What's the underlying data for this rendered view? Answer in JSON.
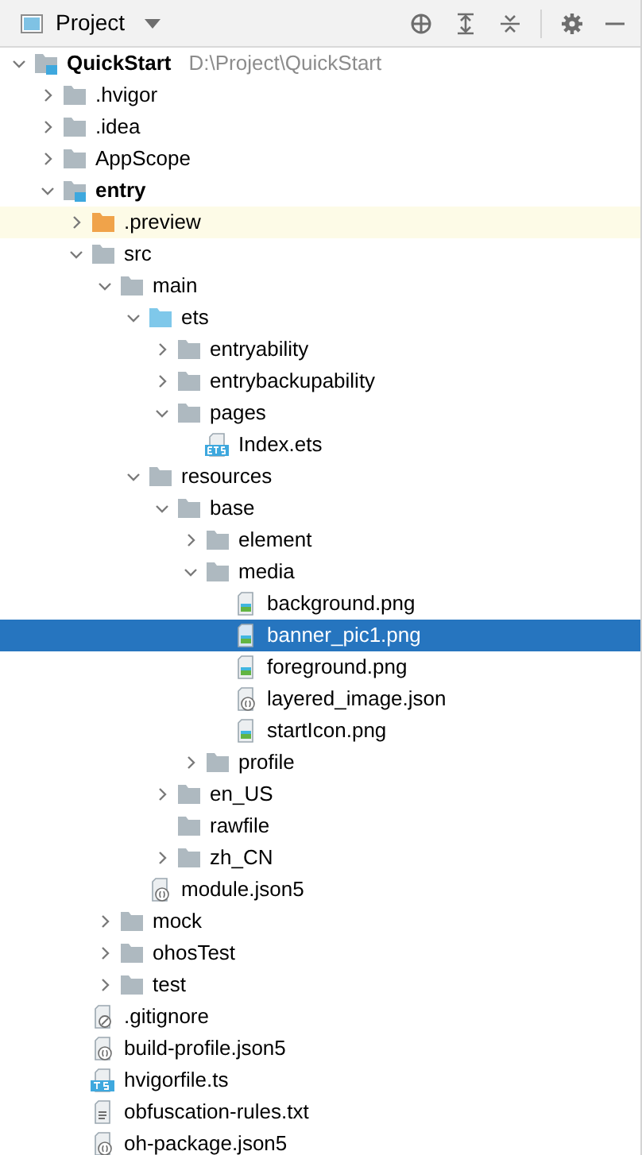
{
  "header": {
    "title": "Project"
  },
  "tree": [
    {
      "label": "QuickStart",
      "path": "D:\\Project\\QuickStart",
      "kind": "module",
      "expanded": true,
      "selected": false,
      "children": [
        {
          "label": ".hvigor",
          "kind": "folder",
          "expanded": false,
          "selected": false
        },
        {
          "label": ".idea",
          "kind": "folder",
          "expanded": false,
          "selected": false
        },
        {
          "label": "AppScope",
          "kind": "folder",
          "expanded": false,
          "selected": false
        },
        {
          "label": "entry",
          "kind": "module",
          "expanded": true,
          "selected": false,
          "children": [
            {
              "label": ".preview",
              "kind": "generated",
              "expanded": false,
              "selected": false
            },
            {
              "label": "src",
              "kind": "folder",
              "expanded": true,
              "selected": false,
              "children": [
                {
                  "label": "main",
                  "kind": "folder",
                  "expanded": true,
                  "selected": false,
                  "children": [
                    {
                      "label": "ets",
                      "kind": "source",
                      "expanded": true,
                      "selected": false,
                      "children": [
                        {
                          "label": "entryability",
                          "kind": "folder",
                          "expanded": false,
                          "selected": false
                        },
                        {
                          "label": "entrybackupability",
                          "kind": "folder",
                          "expanded": false,
                          "selected": false
                        },
                        {
                          "label": "pages",
                          "kind": "folder",
                          "expanded": true,
                          "selected": false,
                          "children": [
                            {
                              "label": "Index.ets",
                              "kind": "ets",
                              "selected": false
                            }
                          ]
                        }
                      ]
                    },
                    {
                      "label": "resources",
                      "kind": "folder",
                      "expanded": true,
                      "selected": false,
                      "children": [
                        {
                          "label": "base",
                          "kind": "folder",
                          "expanded": true,
                          "selected": false,
                          "children": [
                            {
                              "label": "element",
                              "kind": "folder",
                              "expanded": false,
                              "selected": false
                            },
                            {
                              "label": "media",
                              "kind": "folder",
                              "expanded": true,
                              "selected": false,
                              "children": [
                                {
                                  "label": "background.png",
                                  "kind": "image",
                                  "selected": false
                                },
                                {
                                  "label": "banner_pic1.png",
                                  "kind": "image",
                                  "selected": true
                                },
                                {
                                  "label": "foreground.png",
                                  "kind": "image",
                                  "selected": false
                                },
                                {
                                  "label": "layered_image.json",
                                  "kind": "json",
                                  "selected": false
                                },
                                {
                                  "label": "startIcon.png",
                                  "kind": "image",
                                  "selected": false
                                }
                              ]
                            },
                            {
                              "label": "profile",
                              "kind": "folder",
                              "expanded": false,
                              "selected": false
                            }
                          ]
                        },
                        {
                          "label": "en_US",
                          "kind": "folder",
                          "expanded": false,
                          "selected": false
                        },
                        {
                          "label": "rawfile",
                          "kind": "folder",
                          "selected": false
                        },
                        {
                          "label": "zh_CN",
                          "kind": "folder",
                          "expanded": false,
                          "selected": false
                        }
                      ]
                    },
                    {
                      "label": "module.json5",
                      "kind": "json",
                      "selected": false
                    }
                  ]
                },
                {
                  "label": "mock",
                  "kind": "folder",
                  "expanded": false,
                  "selected": false
                },
                {
                  "label": "ohosTest",
                  "kind": "folder",
                  "expanded": false,
                  "selected": false
                },
                {
                  "label": "test",
                  "kind": "folder",
                  "expanded": false,
                  "selected": false
                }
              ]
            },
            {
              "label": ".gitignore",
              "kind": "ignore",
              "selected": false
            },
            {
              "label": "build-profile.json5",
              "kind": "json",
              "selected": false
            },
            {
              "label": "hvigorfile.ts",
              "kind": "ts",
              "selected": false
            },
            {
              "label": "obfuscation-rules.txt",
              "kind": "text",
              "selected": false
            },
            {
              "label": "oh-package.json5",
              "kind": "json",
              "selected": false
            }
          ]
        }
      ]
    }
  ]
}
